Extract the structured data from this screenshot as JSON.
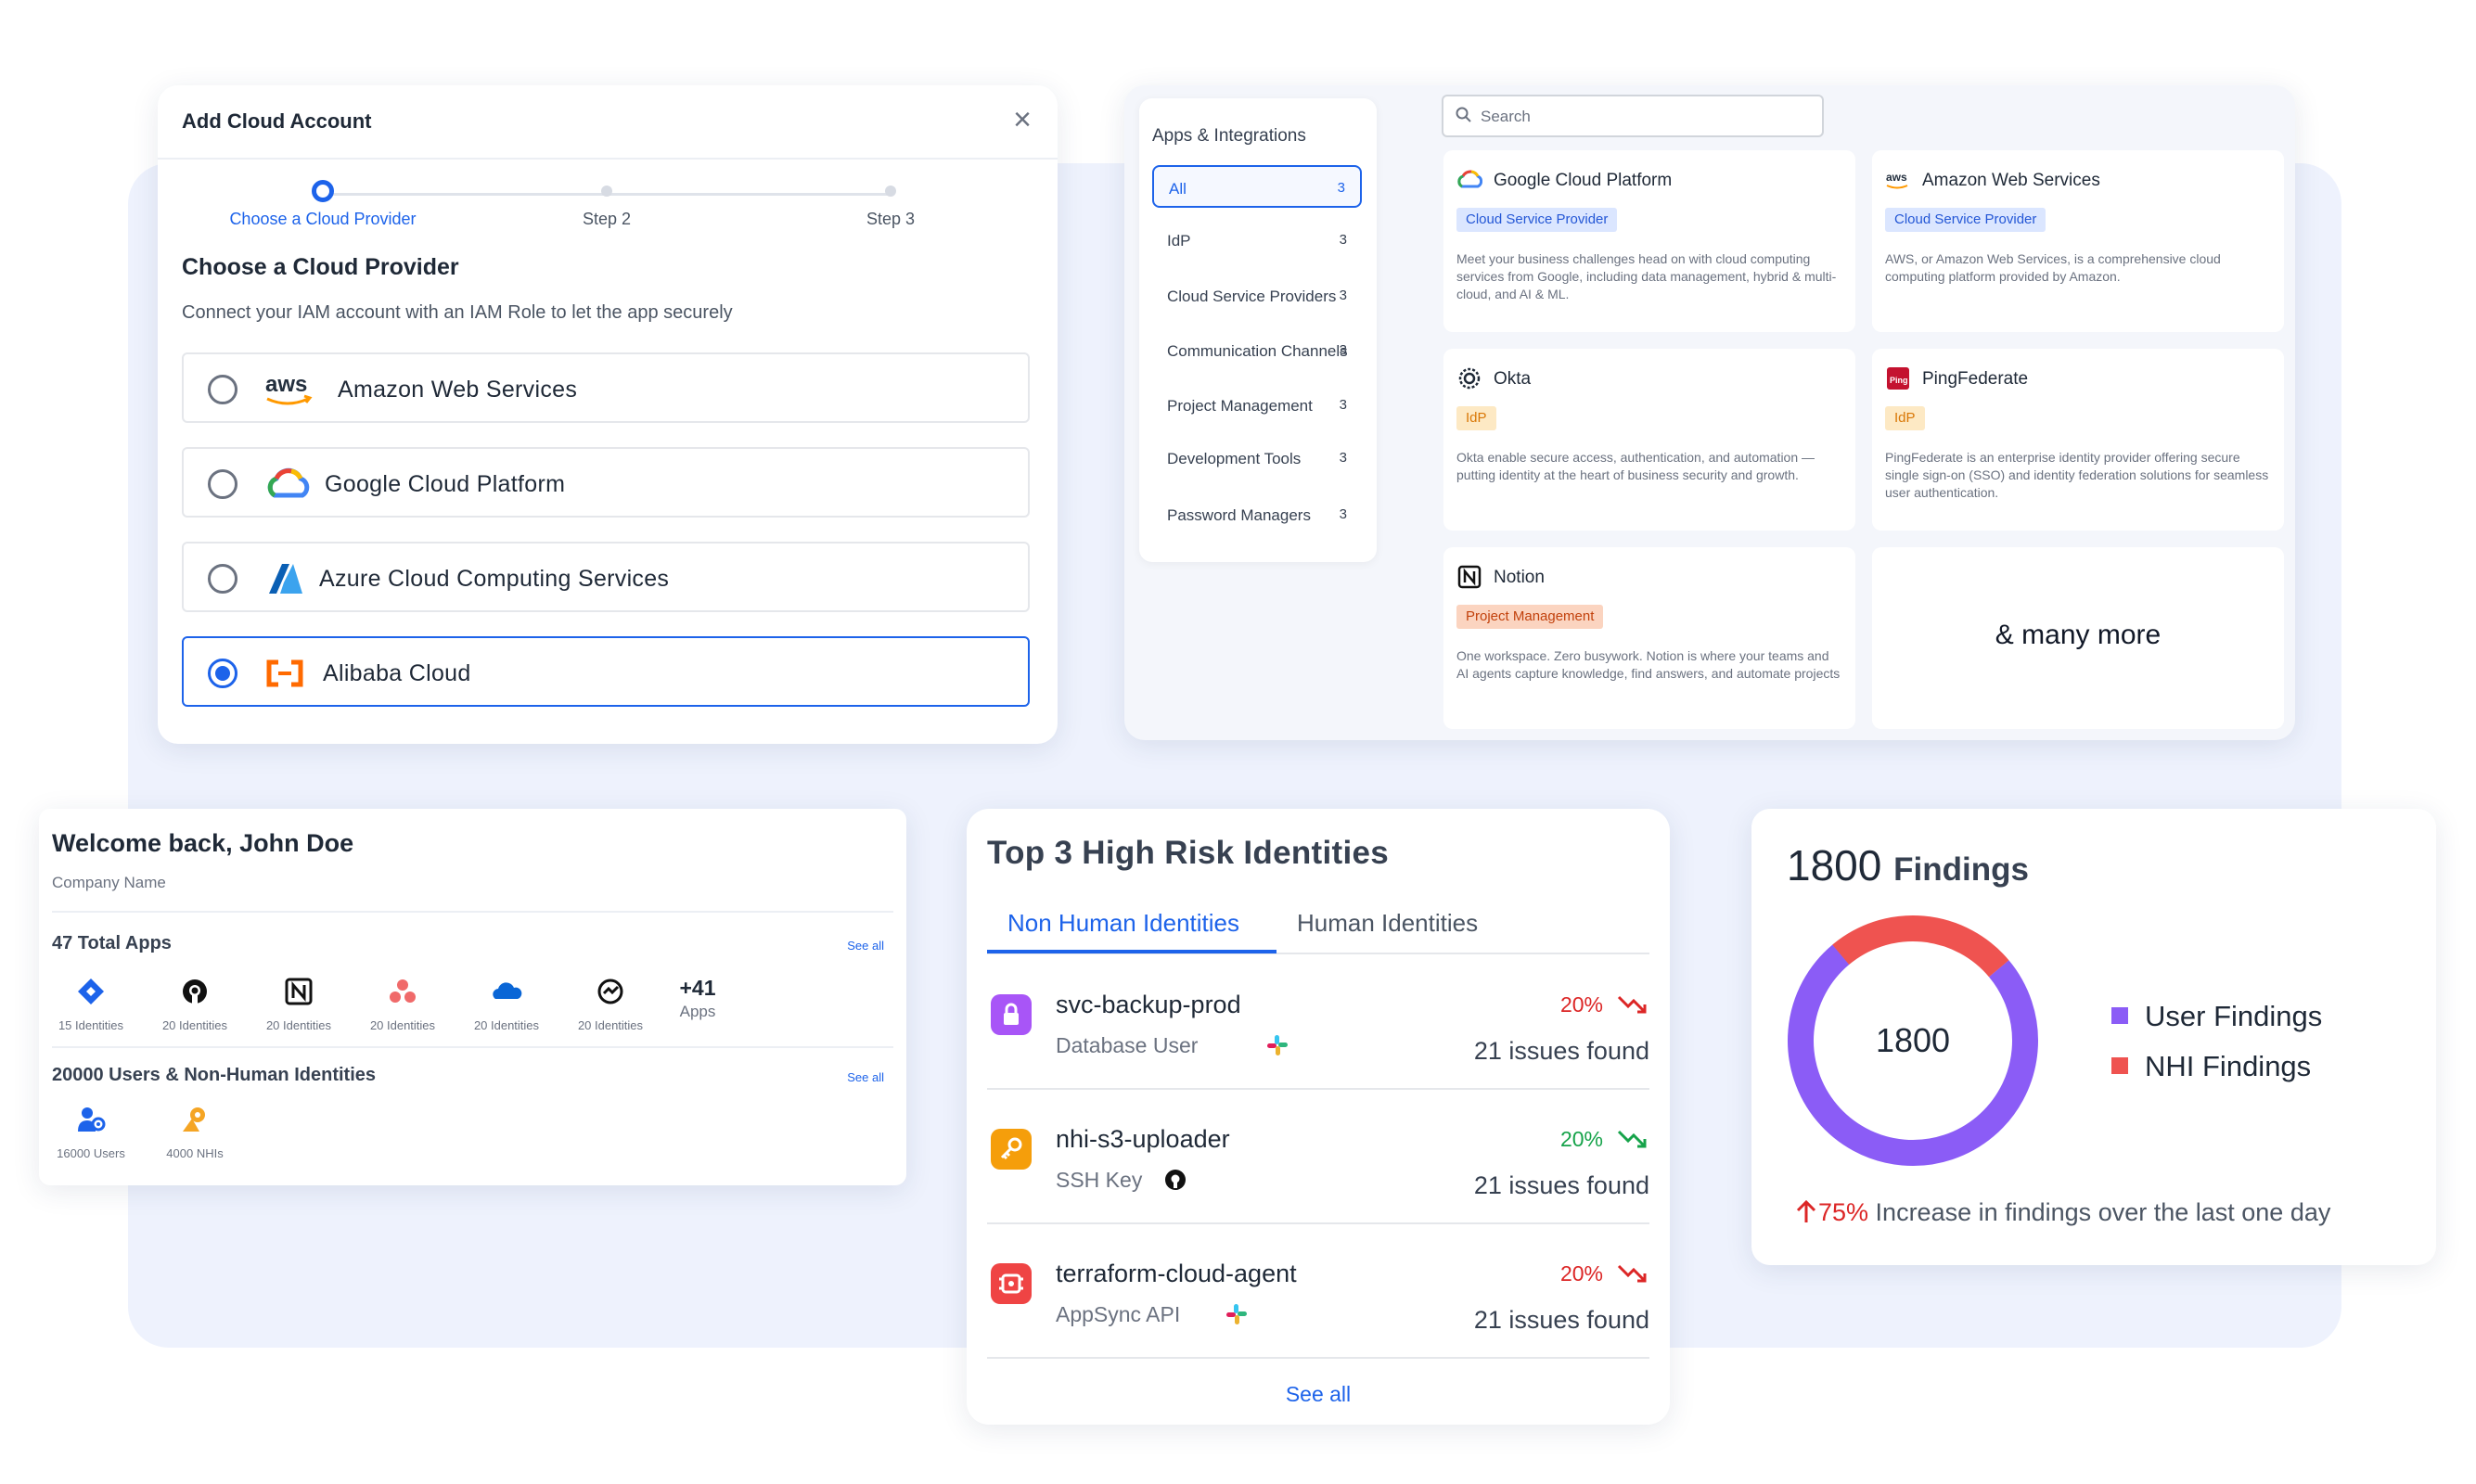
{
  "add_cloud": {
    "title": "Add Cloud Account",
    "close": "×",
    "steps": [
      "Choose a Cloud Provider",
      "Step 2",
      "Step 3"
    ],
    "heading": "Choose a Cloud Provider",
    "description": "Connect your IAM account with an IAM Role to let the app securely",
    "providers": [
      {
        "name": "Amazon Web Services",
        "selected": false
      },
      {
        "name": "Google Cloud Platform",
        "selected": false
      },
      {
        "name": "Azure Cloud Computing Services",
        "selected": false
      },
      {
        "name": "Alibaba Cloud",
        "selected": true
      }
    ],
    "aws_logo_text": "aws"
  },
  "apps": {
    "heading": "Apps & Integrations",
    "search_placeholder": "Search",
    "categories": [
      {
        "label": "All",
        "count": "3",
        "active": true
      },
      {
        "label": "IdP",
        "count": "3"
      },
      {
        "label": "Cloud Service Providers",
        "count": "3"
      },
      {
        "label": "Communication Channels",
        "count": "3"
      },
      {
        "label": "Project Management",
        "count": "3"
      },
      {
        "label": "Development Tools",
        "count": "3"
      },
      {
        "label": "Password Managers",
        "count": "3"
      }
    ],
    "items": [
      {
        "name": "Google Cloud Platform",
        "tag": "Cloud Service Provider",
        "desc": "Meet your business challenges head on with cloud computing services from Google, including data management, hybrid & multi-cloud, and AI & ML."
      },
      {
        "name": "Amazon Web Services",
        "tag": "Cloud Service Provider",
        "desc": "AWS, or Amazon Web Services, is a comprehensive cloud computing platform provided by Amazon.",
        "logo_text": "aws"
      },
      {
        "name": "Okta",
        "tag": "IdP",
        "desc": "Okta enable secure access, authentication, and automation — putting identity at the heart of business security and growth."
      },
      {
        "name": "PingFederate",
        "tag": "IdP",
        "desc": "PingFederate is an enterprise identity provider offering secure single sign-on (SSO) and identity federation solutions for seamless user authentication.",
        "logo_text": "Ping"
      },
      {
        "name": "Notion",
        "tag": "Project Management",
        "desc": "One workspace. Zero busywork. Notion is where your teams and AI agents capture knowledge, find answers, and automate projects"
      }
    ],
    "more": "& many more"
  },
  "welcome": {
    "title": "Welcome back, John Doe",
    "company": "Company Name",
    "apps_title": "47 Total Apps",
    "see_all": "See all",
    "app_icons": [
      {
        "label": "15 Identities",
        "icon": "jira-icon"
      },
      {
        "label": "20 Identities",
        "icon": "github-icon"
      },
      {
        "label": "20 Identities",
        "icon": "notion-icon"
      },
      {
        "label": "20 Identities",
        "icon": "asana-icon"
      },
      {
        "label": "20 Identities",
        "icon": "onedrive-icon"
      },
      {
        "label": "20 Identities",
        "icon": "monitor-icon"
      }
    ],
    "more_count": "+41",
    "more_label": "Apps",
    "users_title": "20000 Users & Non-Human Identities",
    "users": [
      {
        "label": "16000 Users",
        "icon": "users-icon"
      },
      {
        "label": "4000 NHIs",
        "icon": "nhi-icon"
      }
    ]
  },
  "risk": {
    "title": "Top 3 High Risk Identities",
    "tabs": [
      "Non Human Identities",
      "Human Identities"
    ],
    "rows": [
      {
        "name": "svc-backup-prod",
        "type": "Database User",
        "pct": "20%",
        "trend": "down",
        "issues": "21 issues found",
        "color": "#a855f7",
        "pct_color": "red"
      },
      {
        "name": "nhi-s3-uploader",
        "type": "SSH Key",
        "pct": "20%",
        "trend": "down",
        "issues": "21 issues found",
        "color": "#f59e0b",
        "pct_color": "green"
      },
      {
        "name": "terraform-cloud-agent",
        "type": "AppSync API",
        "pct": "20%",
        "trend": "down",
        "issues": "21 issues found",
        "color": "#ef4444",
        "pct_color": "red"
      }
    ],
    "see_all": "See all"
  },
  "findings": {
    "count": "1800",
    "label": "Findings",
    "center": "1800",
    "legend": [
      {
        "label": "User Findings",
        "color": "#8b5cf6"
      },
      {
        "label": "NHI Findings",
        "color": "#ef5350"
      }
    ],
    "segments": {
      "user_fraction": 0.75,
      "nhi_fraction": 0.25
    },
    "increase_pct": "75%",
    "increase_text": " Increase in findings over the last one day"
  },
  "colors": {
    "accent": "#1d63ea",
    "panel_bg": "#eef2fd"
  }
}
